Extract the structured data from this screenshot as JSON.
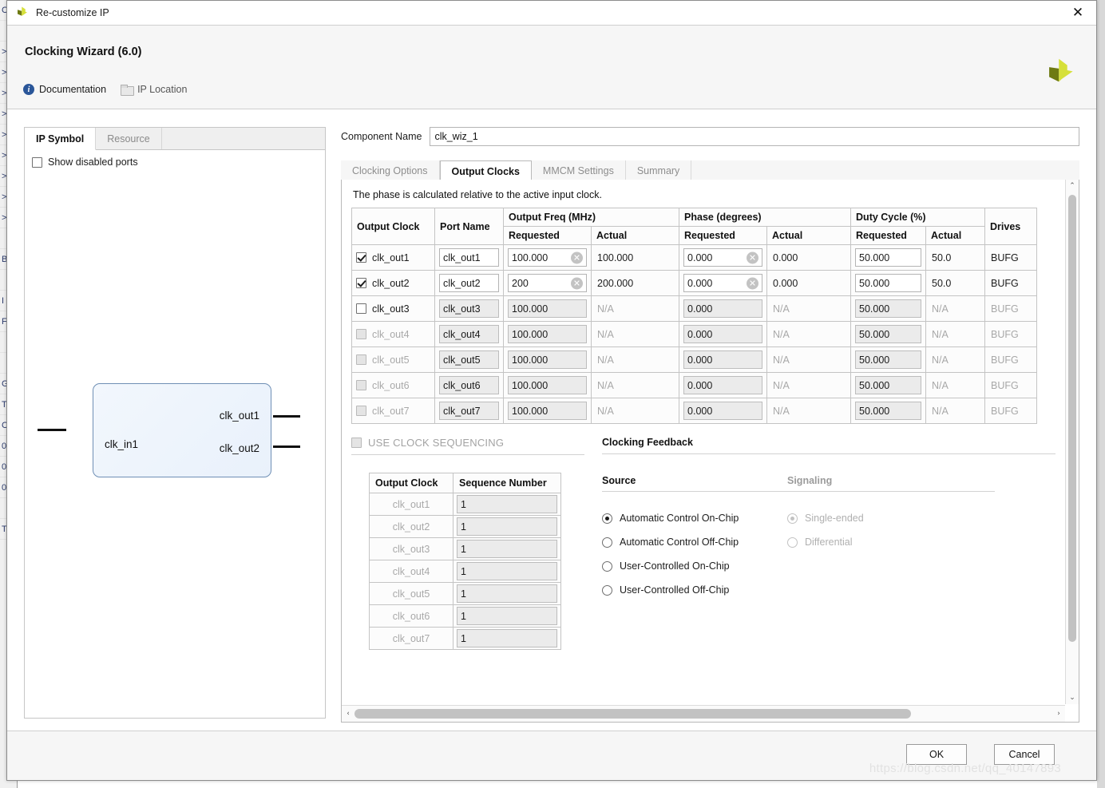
{
  "window": {
    "title": "Re-customize IP",
    "close_label": "✕",
    "app_icon": "xilinx-logo-icon"
  },
  "header": {
    "wizard_title": "Clocking Wizard (6.0)",
    "documentation_label": "Documentation",
    "ip_location_label": "IP Location",
    "info_glyph": "i"
  },
  "left_panel": {
    "tabs": [
      {
        "label": "IP Symbol",
        "active": true
      },
      {
        "label": "Resource",
        "active": false
      }
    ],
    "show_disabled_ports": {
      "label": "Show disabled ports",
      "checked": false
    },
    "symbol": {
      "input_port": "clk_in1",
      "output_ports": [
        "clk_out1",
        "clk_out2"
      ]
    }
  },
  "component": {
    "label": "Component Name",
    "value": "clk_wiz_1"
  },
  "tabs": [
    {
      "label": "Clocking Options",
      "active": false
    },
    {
      "label": "Output Clocks",
      "active": true
    },
    {
      "label": "MMCM Settings",
      "active": false
    },
    {
      "label": "Summary",
      "active": false
    }
  ],
  "note": "The phase is calculated relative to the active input clock.",
  "clock_table": {
    "group_headers": {
      "output_freq": "Output Freq (MHz)",
      "phase": "Phase (degrees)",
      "duty_cycle": "Duty Cycle (%)"
    },
    "headers": {
      "output_clock": "Output Clock",
      "port_name": "Port Name",
      "freq_requested": "Requested",
      "freq_actual": "Actual",
      "phase_requested": "Requested",
      "phase_actual": "Actual",
      "duty_requested": "Requested",
      "duty_actual": "Actual",
      "drives": "Drives"
    },
    "clear_icon_glyph": "✕",
    "rows": [
      {
        "name": "clk_out1",
        "enabled": true,
        "dimmed": false,
        "port_name": "clk_out1",
        "freq_requested": "100.000",
        "freq_actual": "100.000",
        "phase_requested": "0.000",
        "phase_actual": "0.000",
        "duty_requested": "50.000",
        "duty_actual": "50.0",
        "drives": "BUFG"
      },
      {
        "name": "clk_out2",
        "enabled": true,
        "dimmed": false,
        "port_name": "clk_out2",
        "freq_requested": "200",
        "freq_actual": "200.000",
        "phase_requested": "0.000",
        "phase_actual": "0.000",
        "duty_requested": "50.000",
        "duty_actual": "50.0",
        "drives": "BUFG"
      },
      {
        "name": "clk_out3",
        "enabled": false,
        "dimmed": false,
        "port_name": "clk_out3",
        "freq_requested": "100.000",
        "freq_actual": "N/A",
        "phase_requested": "0.000",
        "phase_actual": "N/A",
        "duty_requested": "50.000",
        "duty_actual": "N/A",
        "drives": "BUFG"
      },
      {
        "name": "clk_out4",
        "enabled": false,
        "dimmed": true,
        "port_name": "clk_out4",
        "freq_requested": "100.000",
        "freq_actual": "N/A",
        "phase_requested": "0.000",
        "phase_actual": "N/A",
        "duty_requested": "50.000",
        "duty_actual": "N/A",
        "drives": "BUFG"
      },
      {
        "name": "clk_out5",
        "enabled": false,
        "dimmed": true,
        "port_name": "clk_out5",
        "freq_requested": "100.000",
        "freq_actual": "N/A",
        "phase_requested": "0.000",
        "phase_actual": "N/A",
        "duty_requested": "50.000",
        "duty_actual": "N/A",
        "drives": "BUFG"
      },
      {
        "name": "clk_out6",
        "enabled": false,
        "dimmed": true,
        "port_name": "clk_out6",
        "freq_requested": "100.000",
        "freq_actual": "N/A",
        "phase_requested": "0.000",
        "phase_actual": "N/A",
        "duty_requested": "50.000",
        "duty_actual": "N/A",
        "drives": "BUFG"
      },
      {
        "name": "clk_out7",
        "enabled": false,
        "dimmed": true,
        "port_name": "clk_out7",
        "freq_requested": "100.000",
        "freq_actual": "N/A",
        "phase_requested": "0.000",
        "phase_actual": "N/A",
        "duty_requested": "50.000",
        "duty_actual": "N/A",
        "drives": "BUFG"
      }
    ]
  },
  "sequencing": {
    "checkbox_label": "USE CLOCK SEQUENCING",
    "checked": false,
    "headers": {
      "output_clock": "Output Clock",
      "sequence_number": "Sequence Number"
    },
    "rows": [
      {
        "name": "clk_out1",
        "sequence": "1"
      },
      {
        "name": "clk_out2",
        "sequence": "1"
      },
      {
        "name": "clk_out3",
        "sequence": "1"
      },
      {
        "name": "clk_out4",
        "sequence": "1"
      },
      {
        "name": "clk_out5",
        "sequence": "1"
      },
      {
        "name": "clk_out6",
        "sequence": "1"
      },
      {
        "name": "clk_out7",
        "sequence": "1"
      }
    ]
  },
  "clocking_feedback": {
    "title": "Clocking Feedback",
    "source": {
      "title": "Source",
      "options": [
        {
          "label": "Automatic Control On-Chip",
          "selected": true
        },
        {
          "label": "Automatic Control Off-Chip",
          "selected": false
        },
        {
          "label": "User-Controlled On-Chip",
          "selected": false
        },
        {
          "label": "User-Controlled Off-Chip",
          "selected": false
        }
      ]
    },
    "signaling": {
      "title": "Signaling",
      "disabled": true,
      "options": [
        {
          "label": "Single-ended",
          "selected": true
        },
        {
          "label": "Differential",
          "selected": false
        }
      ]
    }
  },
  "scrollbars": {
    "up_arrow": "⌃",
    "down_arrow": "⌄",
    "left_arrow": "‹",
    "right_arrow": "›"
  },
  "footer": {
    "ok_label": "OK",
    "cancel_label": "Cancel"
  },
  "watermark": "https://blog.csdn.net/qq_40147893",
  "background_window": {
    "rows": [
      "C",
      "",
      ">",
      ">",
      ">",
      ">",
      ">",
      ">",
      ">",
      ">",
      ">",
      "",
      "BI",
      "",
      "I",
      "F",
      "",
      "",
      "G",
      "To",
      "C",
      "0",
      "0",
      "0",
      "",
      "T"
    ]
  },
  "colors": {
    "accent": "#2a5699",
    "logo_light": "#d6e03a",
    "logo_dark": "#6e7a12",
    "symbol_fill": "#eef4fc",
    "symbol_border": "#6f8fb5"
  }
}
